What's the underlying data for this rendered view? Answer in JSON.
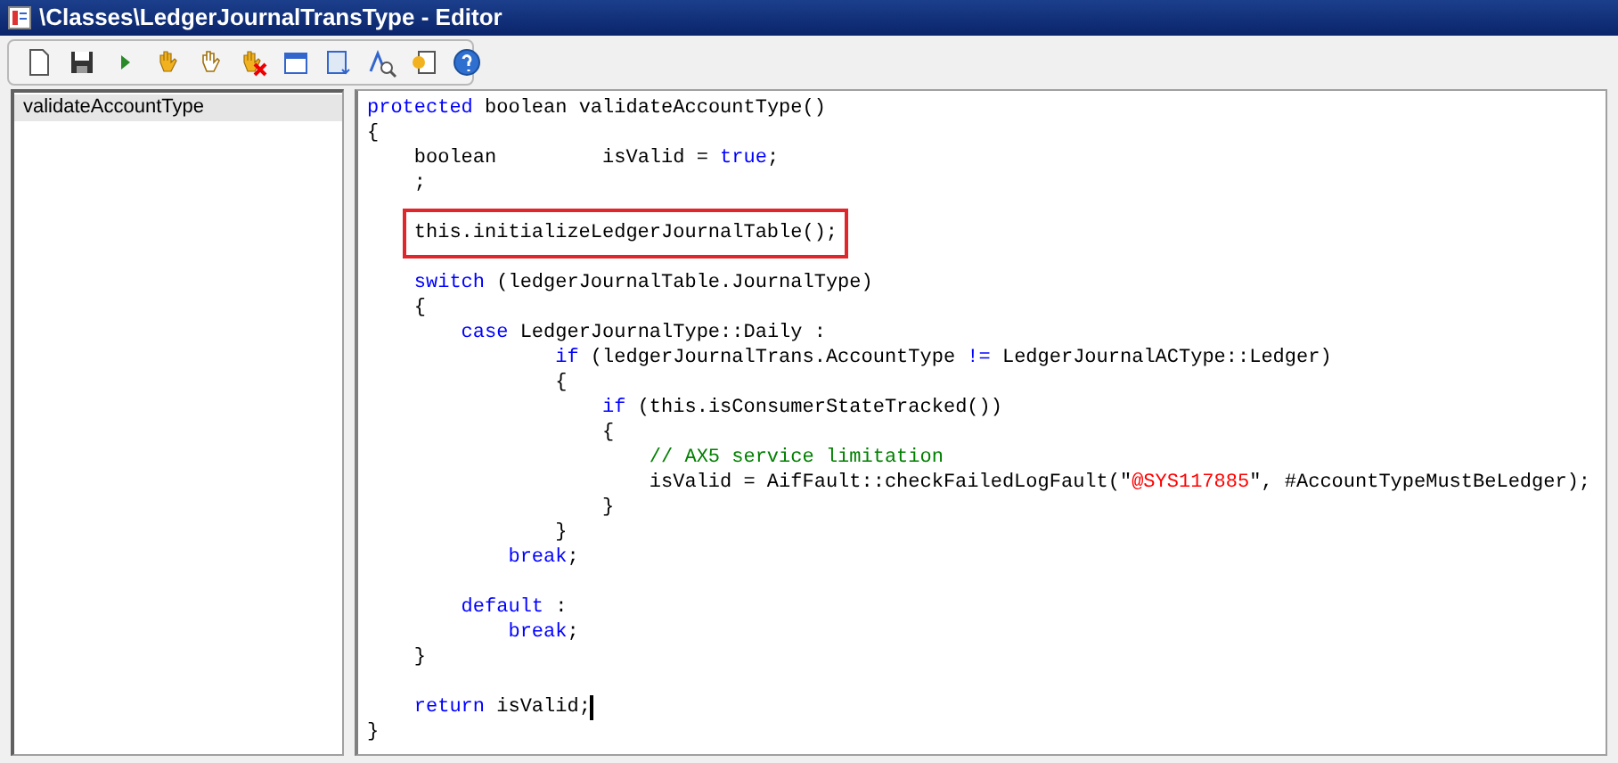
{
  "window": {
    "title": "\\Classes\\LedgerJournalTransType - Editor"
  },
  "sidebar": {
    "items": [
      {
        "label": "validateAccountType",
        "selected": true
      }
    ]
  },
  "code": {
    "lines": [
      {
        "kind": "code",
        "tokens": [
          {
            "text": "protected",
            "kind": "keyword"
          },
          {
            "text": " boolean validateAccountType()",
            "kind": "plain"
          }
        ]
      },
      {
        "kind": "code",
        "tokens": [
          {
            "text": "{",
            "kind": "plain"
          }
        ]
      },
      {
        "kind": "code",
        "tokens": [
          {
            "text": "    boolean         isValid = ",
            "kind": "plain"
          },
          {
            "text": "true",
            "kind": "keyword"
          },
          {
            "text": ";",
            "kind": "plain"
          }
        ]
      },
      {
        "kind": "code",
        "tokens": [
          {
            "text": "    ;",
            "kind": "plain"
          }
        ]
      },
      {
        "kind": "blank"
      },
      {
        "kind": "code",
        "boxed": true,
        "tokens": [
          {
            "text": "    this.initializeLedgerJournalTable();",
            "kind": "plain"
          }
        ]
      },
      {
        "kind": "blank"
      },
      {
        "kind": "code",
        "tokens": [
          {
            "text": "    switch",
            "kind": "keyword"
          },
          {
            "text": " (ledgerJournalTable.JournalType)",
            "kind": "plain"
          }
        ]
      },
      {
        "kind": "code",
        "tokens": [
          {
            "text": "    {",
            "kind": "plain"
          }
        ]
      },
      {
        "kind": "code",
        "tokens": [
          {
            "text": "        case",
            "kind": "keyword"
          },
          {
            "text": " LedgerJournalType::Daily :",
            "kind": "plain"
          }
        ]
      },
      {
        "kind": "code",
        "tokens": [
          {
            "text": "                if",
            "kind": "keyword"
          },
          {
            "text": " (ledgerJournalTrans.AccountType ",
            "kind": "plain"
          },
          {
            "text": "!=",
            "kind": "keyword"
          },
          {
            "text": " LedgerJournalACType::Ledger)",
            "kind": "plain"
          }
        ]
      },
      {
        "kind": "code",
        "tokens": [
          {
            "text": "                {",
            "kind": "plain"
          }
        ]
      },
      {
        "kind": "code",
        "tokens": [
          {
            "text": "                    if",
            "kind": "keyword"
          },
          {
            "text": " (this.isConsumerStateTracked())",
            "kind": "plain"
          }
        ]
      },
      {
        "kind": "code",
        "tokens": [
          {
            "text": "                    {",
            "kind": "plain"
          }
        ]
      },
      {
        "kind": "code",
        "tokens": [
          {
            "text": "                        // AX5 service limitation",
            "kind": "comment"
          }
        ]
      },
      {
        "kind": "code",
        "tokens": [
          {
            "text": "                        isValid = AifFault::checkFailedLogFault(\"",
            "kind": "plain"
          },
          {
            "text": "@SYS117885",
            "kind": "string"
          },
          {
            "text": "\", #AccountTypeMustBeLedger);",
            "kind": "plain"
          }
        ]
      },
      {
        "kind": "code",
        "tokens": [
          {
            "text": "                    }",
            "kind": "plain"
          }
        ]
      },
      {
        "kind": "code",
        "tokens": [
          {
            "text": "                }",
            "kind": "plain"
          }
        ]
      },
      {
        "kind": "code",
        "tokens": [
          {
            "text": "            break",
            "kind": "keyword"
          },
          {
            "text": ";",
            "kind": "plain"
          }
        ]
      },
      {
        "kind": "blank"
      },
      {
        "kind": "code",
        "tokens": [
          {
            "text": "        default",
            "kind": "keyword"
          },
          {
            "text": " :",
            "kind": "plain"
          }
        ]
      },
      {
        "kind": "code",
        "tokens": [
          {
            "text": "            break",
            "kind": "keyword"
          },
          {
            "text": ";",
            "kind": "plain"
          }
        ]
      },
      {
        "kind": "code",
        "tokens": [
          {
            "text": "    }",
            "kind": "plain"
          }
        ]
      },
      {
        "kind": "blank"
      },
      {
        "kind": "code",
        "caret": true,
        "tokens": [
          {
            "text": "    return",
            "kind": "keyword"
          },
          {
            "text": " isValid;",
            "kind": "plain"
          }
        ]
      },
      {
        "kind": "code",
        "tokens": [
          {
            "text": "}",
            "kind": "plain"
          }
        ]
      }
    ]
  }
}
